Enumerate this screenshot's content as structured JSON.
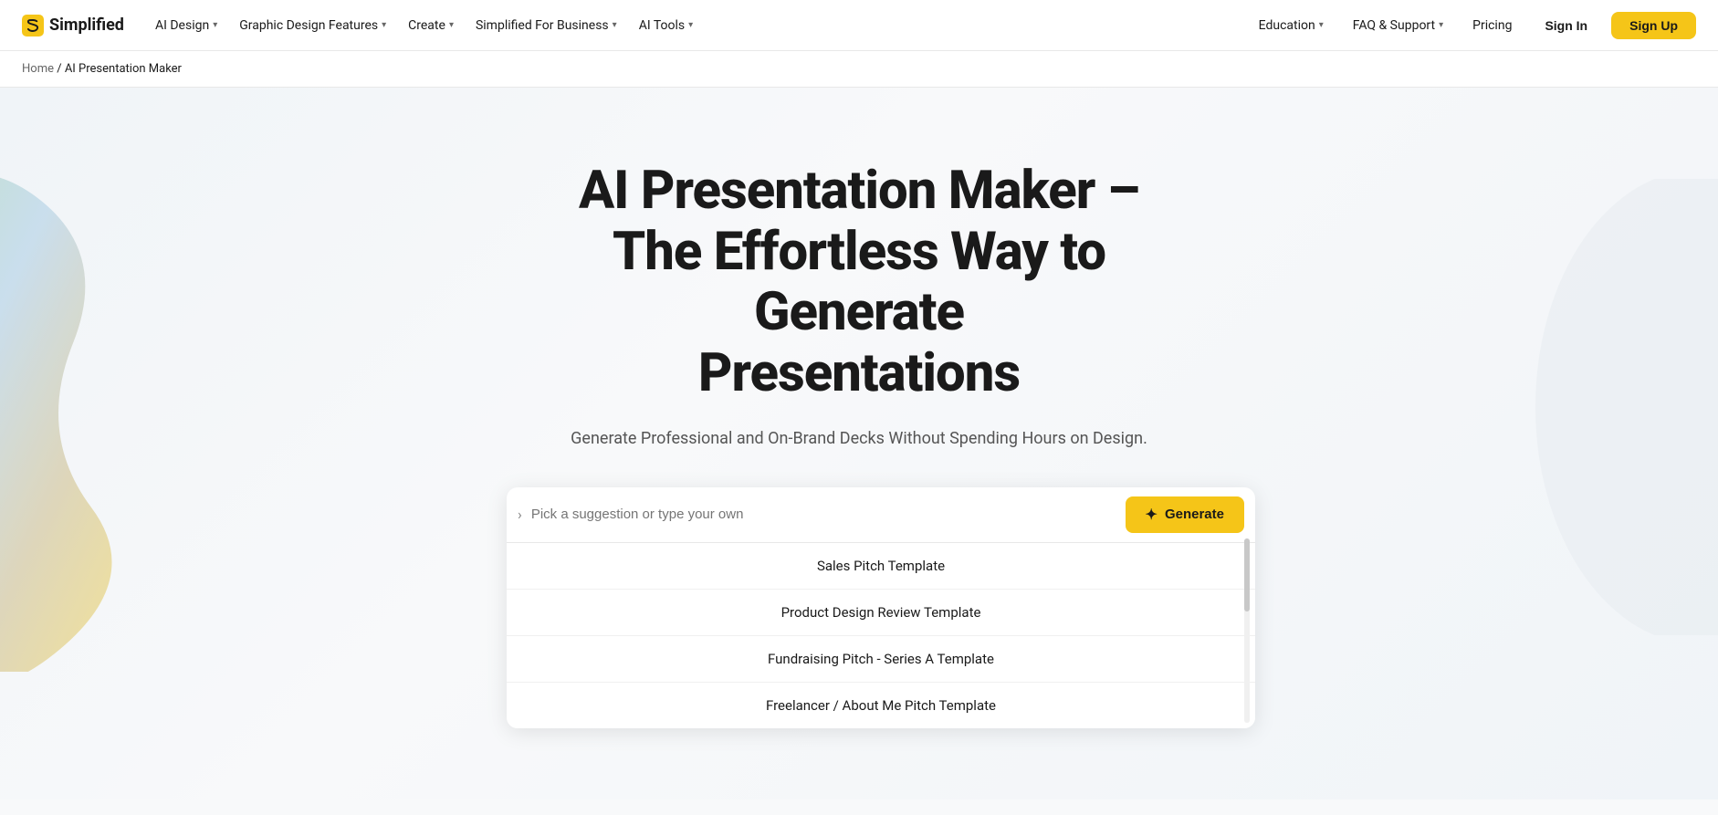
{
  "logo": {
    "text": "Simplified",
    "icon": "S"
  },
  "nav": {
    "items": [
      {
        "label": "AI Design",
        "hasDropdown": true
      },
      {
        "label": "Graphic Design Features",
        "hasDropdown": true
      },
      {
        "label": "Create",
        "hasDropdown": true
      },
      {
        "label": "Simplified For Business",
        "hasDropdown": true
      },
      {
        "label": "AI Tools",
        "hasDropdown": true
      }
    ],
    "rightItems": [
      {
        "label": "Education",
        "hasDropdown": true
      },
      {
        "label": "FAQ & Support",
        "hasDropdown": true
      },
      {
        "label": "Pricing",
        "hasDropdown": false
      }
    ],
    "signin_label": "Sign In",
    "signup_label": "Sign Up"
  },
  "breadcrumb": {
    "home": "Home",
    "separator": "/",
    "current": "AI Presentation Maker"
  },
  "hero": {
    "title": "AI Presentation Maker –\nThe Effortless Way to Generate\nPresentations",
    "subtitle": "Generate Professional and On-Brand Decks Without Spending Hours on Design.",
    "search_placeholder": "Pick a suggestion or type your own",
    "generate_label": "Generate",
    "suggestions": [
      "Sales Pitch Template",
      "Product Design Review Template",
      "Fundraising Pitch - Series A Template",
      "Freelancer / About Me Pitch Template"
    ]
  }
}
